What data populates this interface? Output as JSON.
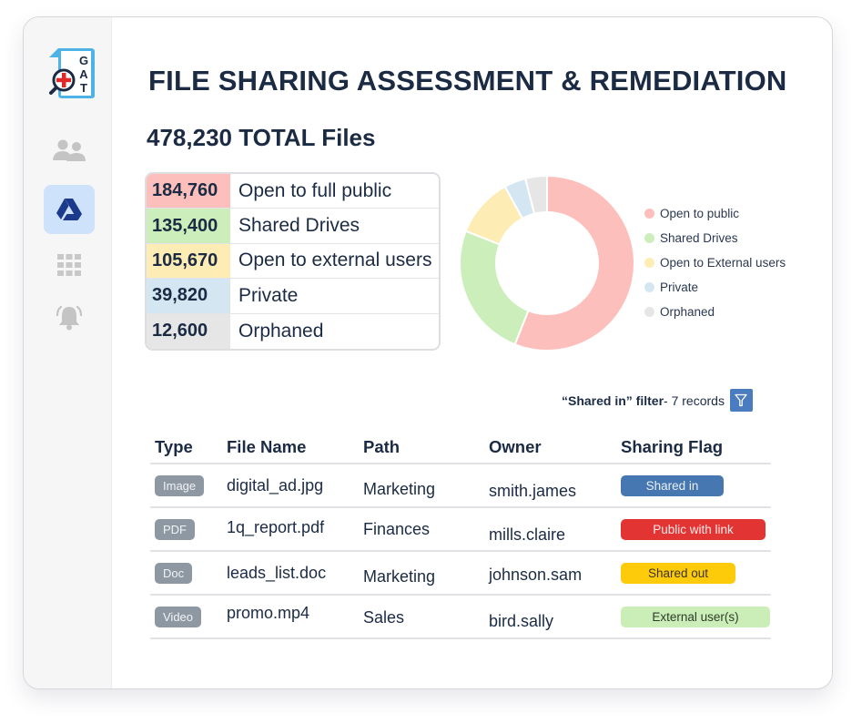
{
  "sidebar": {
    "logo": {
      "letters": [
        "G",
        "A",
        "T"
      ]
    },
    "items": [
      {
        "name": "users",
        "icon": "users-icon",
        "active": false
      },
      {
        "name": "drive",
        "icon": "google-drive-icon",
        "active": true
      },
      {
        "name": "apps",
        "icon": "apps-grid-icon",
        "active": false
      },
      {
        "name": "alerts",
        "icon": "bell-icon",
        "active": false
      }
    ]
  },
  "header": {
    "title": "FILE SHARING ASSESSMENT & REMEDIATION",
    "total": "478,230 TOTAL Files"
  },
  "summary": {
    "rows": [
      {
        "count": "184,760",
        "label": "Open to full public",
        "color": "#fdbfbb"
      },
      {
        "count": "135,400",
        "label": "Shared Drives",
        "color": "#cbeebb"
      },
      {
        "count": "105,670",
        "label": "Open to external users",
        "color": "#fdedb5"
      },
      {
        "count": "39,820",
        "label": "Private",
        "color": "#d5e6f3"
      },
      {
        "count": "12,600",
        "label": "Orphaned",
        "color": "#e6e6e6"
      }
    ]
  },
  "chart_data": {
    "type": "pie",
    "variant": "donut",
    "title": "",
    "legend_position": "right",
    "categories": [
      "Open to public",
      "Shared Drives",
      "Open to External users",
      "Private",
      "Orphaned"
    ],
    "values": [
      56,
      25,
      11,
      4,
      4
    ],
    "unit": "percent (approx., read from slice angles)",
    "colors": [
      "#fdbfbb",
      "#cbeebb",
      "#fdedb5",
      "#d5e6f3",
      "#e6e6e6"
    ]
  },
  "filter": {
    "name": "“Shared in” filter",
    "records": " - 7 records",
    "icon": "filter-icon"
  },
  "table": {
    "columns": [
      "Type",
      "File Name",
      "Path",
      "Owner",
      "Sharing Flag"
    ],
    "rows": [
      {
        "type": "Image",
        "name": "digital_ad.jpg",
        "path": "Marketing",
        "owner": "smith.james",
        "flag": "Shared in",
        "flag_bg": "#4677b0",
        "flag_fg": "#e9f0f8"
      },
      {
        "type": "PDF",
        "name": "1q_report.pdf",
        "path": "Finances",
        "owner": "mills.claire",
        "flag": "Public with link",
        "flag_bg": "#e33434",
        "flag_fg": "#fde8e8"
      },
      {
        "type": "Doc",
        "name": "leads_list.doc",
        "path": "Marketing",
        "owner": "johnson.sam",
        "flag": "Shared out",
        "flag_bg": "#fdcb0a",
        "flag_fg": "#3a3320"
      },
      {
        "type": "Video",
        "name": "promo.mp4",
        "path": "Sales",
        "owner": "bird.sally",
        "flag": "External user(s)",
        "flag_bg": "#cbedb7",
        "flag_fg": "#2e3d2a"
      }
    ]
  }
}
